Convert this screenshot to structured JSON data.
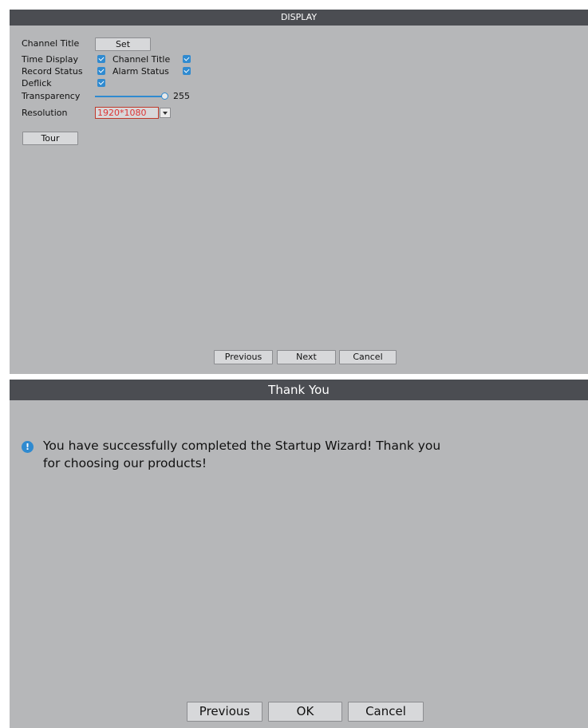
{
  "display": {
    "title": "DISPLAY",
    "channel_title_label": "Channel Title",
    "set_button": "Set",
    "time_display_label": "Time Display",
    "time_display_checked": true,
    "channel_title_toggle_label": "Channel Title",
    "channel_title_checked": true,
    "record_status_label": "Record Status",
    "record_status_checked": true,
    "alarm_status_label": "Alarm Status",
    "alarm_status_checked": true,
    "deflick_label": "Deflick",
    "deflick_checked": true,
    "transparency_label": "Transparency",
    "transparency_value": "255",
    "transparency_level": 1.0,
    "resolution_label": "Resolution",
    "resolution_value": "1920*1080",
    "tour_button": "Tour",
    "previous_button": "Previous",
    "next_button": "Next",
    "cancel_button": "Cancel"
  },
  "thanks": {
    "title": "Thank You",
    "message_line1": "You have successfully completed the Startup Wizard! Thank you",
    "message_line2": "for choosing our products!",
    "info_icon": "info-icon",
    "previous_button": "Previous",
    "ok_button": "OK",
    "cancel_button": "Cancel"
  },
  "colors": {
    "panel_bg": "#b6b7b9",
    "titlebar_bg": "#4b4d52",
    "accent": "#2f8ad0",
    "resolution_text": "#dd3333"
  }
}
